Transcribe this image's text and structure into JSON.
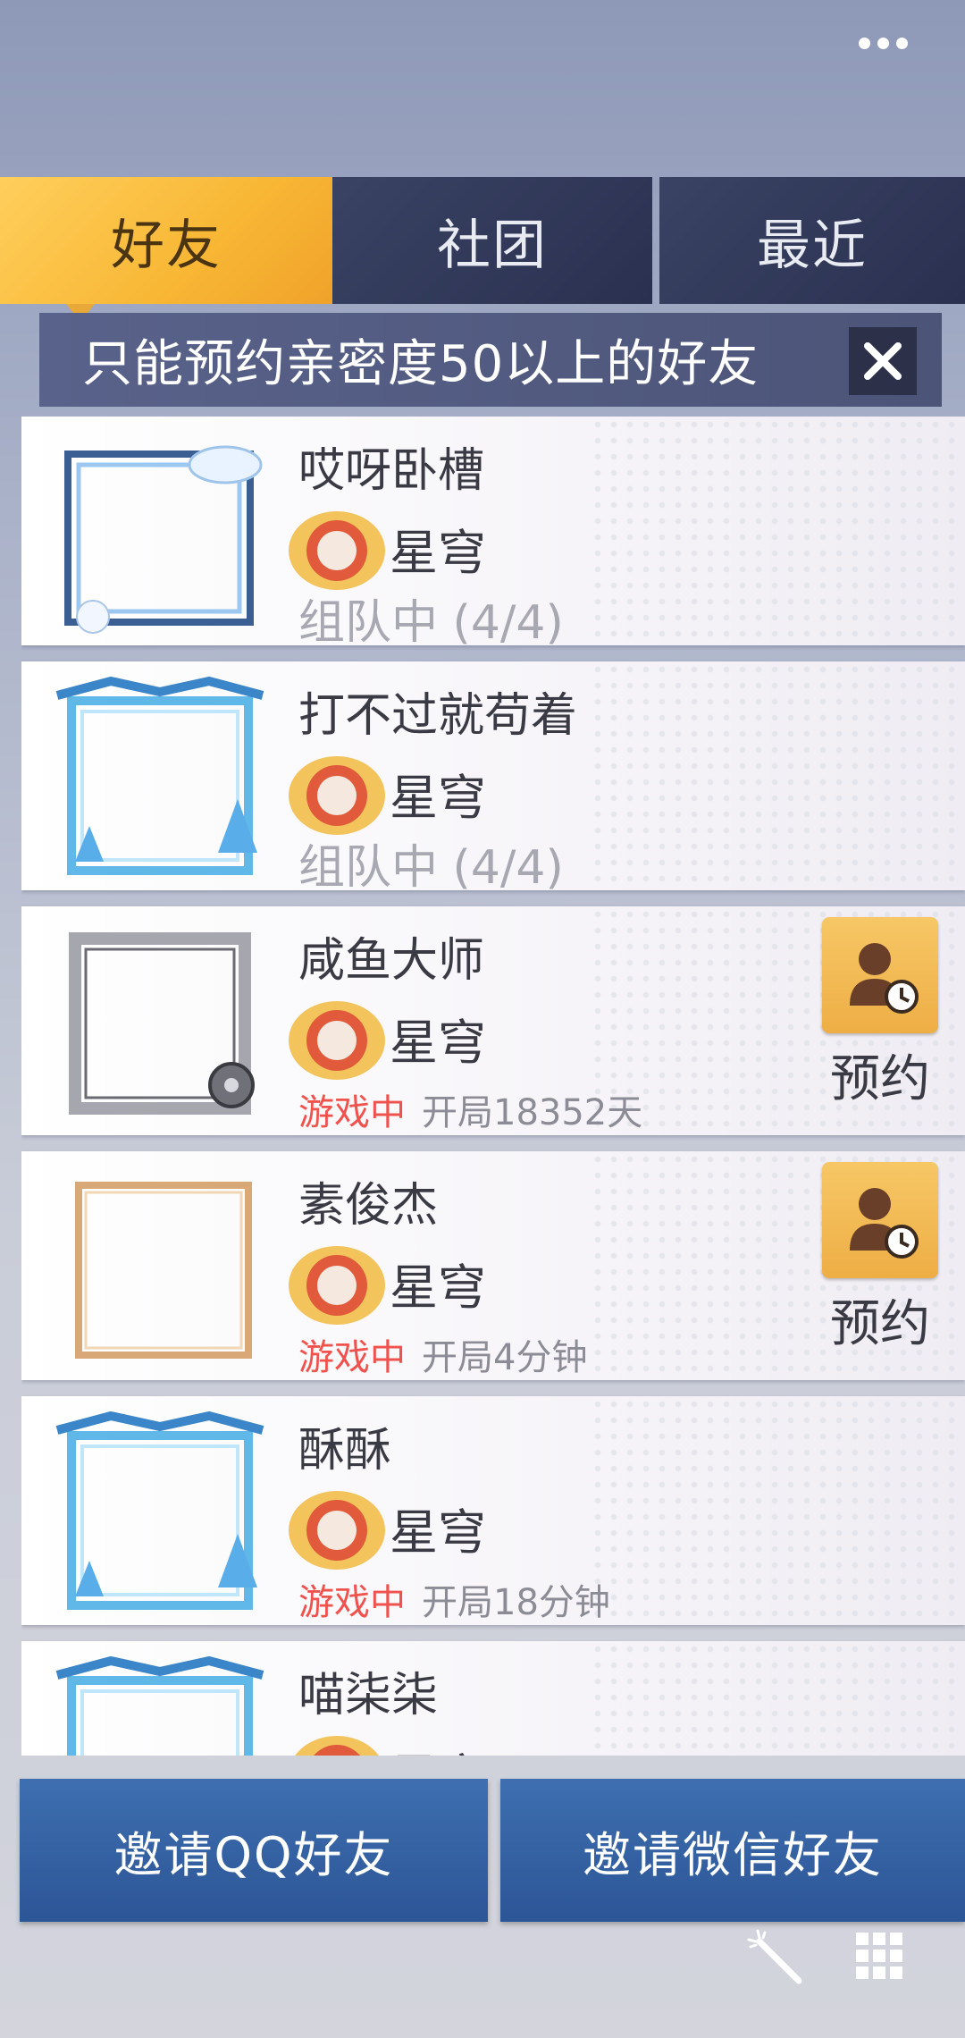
{
  "header": {
    "more_icon": "more-dots-icon"
  },
  "tabs": [
    {
      "label": "好友",
      "active": true
    },
    {
      "label": "社团",
      "active": false
    },
    {
      "label": "最近",
      "active": false
    }
  ],
  "notice": {
    "text": "只能预约亲密度50以上的好友",
    "close_icon": "close-icon"
  },
  "friends": [
    {
      "name": "哎呀卧槽",
      "rank": "星穹",
      "status": "组队中 (4/4)",
      "frame": "cloud"
    },
    {
      "name": "打不过就苟着",
      "rank": "星穹",
      "status": "组队中 (4/4)",
      "frame": "ice"
    },
    {
      "name": "咸鱼大师",
      "rank": "星穹",
      "status": "游戏中",
      "detail": "开局18352天",
      "frame": "silver",
      "reserve": "预约"
    },
    {
      "name": "素俊杰",
      "rank": "星穹",
      "status": "游戏中",
      "detail": "开局4分钟",
      "frame": "gold",
      "reserve": "预约"
    },
    {
      "name": "酥酥",
      "rank": "星穹",
      "status": "游戏中",
      "detail": "开局18分钟",
      "frame": "ice"
    },
    {
      "name": "喵柒柒",
      "rank": "星穹",
      "frame": "ice"
    }
  ],
  "buttons": {
    "invite_qq": "邀请QQ好友",
    "invite_wechat": "邀请微信好友"
  },
  "colors": {
    "tab_active": "#f8b735",
    "tab_inactive": "#2f3655",
    "status_playing": "#f0524e",
    "invite_button": "#2f5a9c"
  }
}
